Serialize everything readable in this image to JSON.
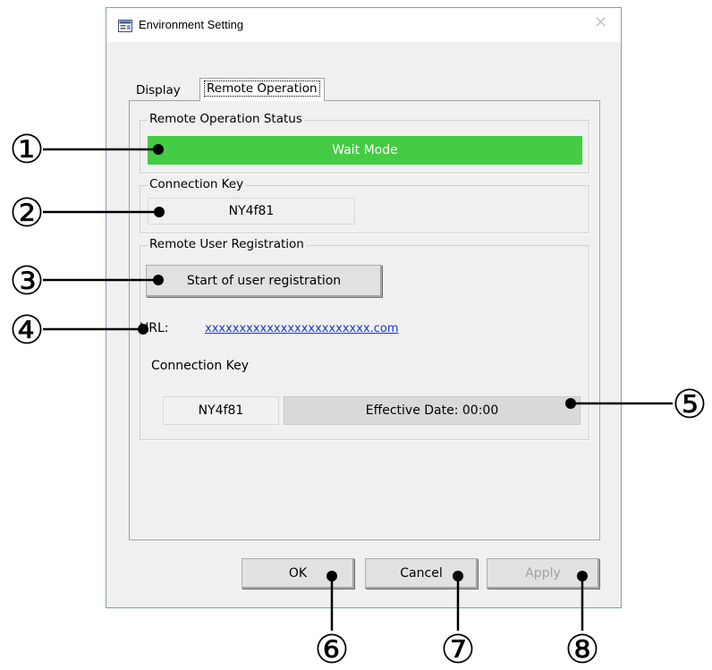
{
  "window": {
    "title": "Environment Setting",
    "close_glyph": "✕",
    "icon": "app-settings-icon"
  },
  "tabs": [
    {
      "label": "Display",
      "active": false
    },
    {
      "label": "Remote Operation",
      "active": true
    }
  ],
  "remote_status": {
    "legend": "Remote Operation Status",
    "value": "Wait Mode",
    "color": "#44cc44"
  },
  "connection_key": {
    "legend": "Connection Key",
    "value": "NY4f81"
  },
  "registration": {
    "legend": "Remote User Registration",
    "start_button": "Start of user registration",
    "url_label": "URL:",
    "url_value": "xxxxxxxxxxxxxxxxxxxxxxxx.com",
    "key_label": "Connection Key",
    "key_value": "NY4f81",
    "effective_date": "Effective Date: 00:00"
  },
  "buttons": {
    "ok": "OK",
    "cancel": "Cancel",
    "apply": "Apply",
    "apply_enabled": false
  },
  "callouts": [
    "①",
    "②",
    "③",
    "④",
    "⑤",
    "⑥",
    "⑦",
    "⑧"
  ]
}
